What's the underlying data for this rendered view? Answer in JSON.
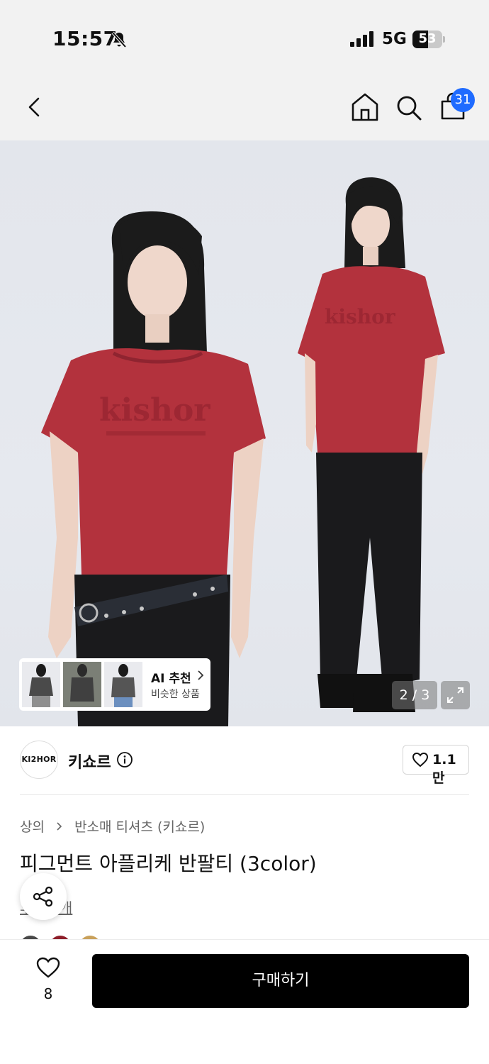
{
  "status_bar": {
    "time": "15:57",
    "network": "5G",
    "battery_level": "53",
    "bell_icon": "bell-slash-icon",
    "signal_icon": "signal-bars-icon"
  },
  "nav": {
    "back_icon": "chevron-left-icon",
    "home_icon": "home-icon",
    "search_icon": "search-icon",
    "cart_icon": "shopping-bag-icon",
    "cart_count": "31"
  },
  "gallery": {
    "page_counter": "2 / 3",
    "expand_icon": "expand-icon",
    "ai_card": {
      "title": "AI 추천",
      "subtitle": "비슷한 상품"
    }
  },
  "brand": {
    "logo_text": "KI2HOR",
    "name": "키쇼르",
    "like_count": "1.1만"
  },
  "breadcrumb": {
    "category": "상의",
    "subcategory": "반소매 티셔츠 (키쇼르)"
  },
  "product": {
    "title": "피그먼트 아플리케 반팔티 (3color)",
    "review_link": "후기 1개"
  },
  "bottom": {
    "wish_count": "8",
    "buy_label": "구매하기"
  },
  "colors": {
    "accent": "#1f6bff",
    "shirt_red": "#b3323d",
    "pants_black": "#1a1a1c",
    "swatches": [
      "#4a4a4a",
      "#8e1e2a",
      "#c9a15b"
    ]
  }
}
